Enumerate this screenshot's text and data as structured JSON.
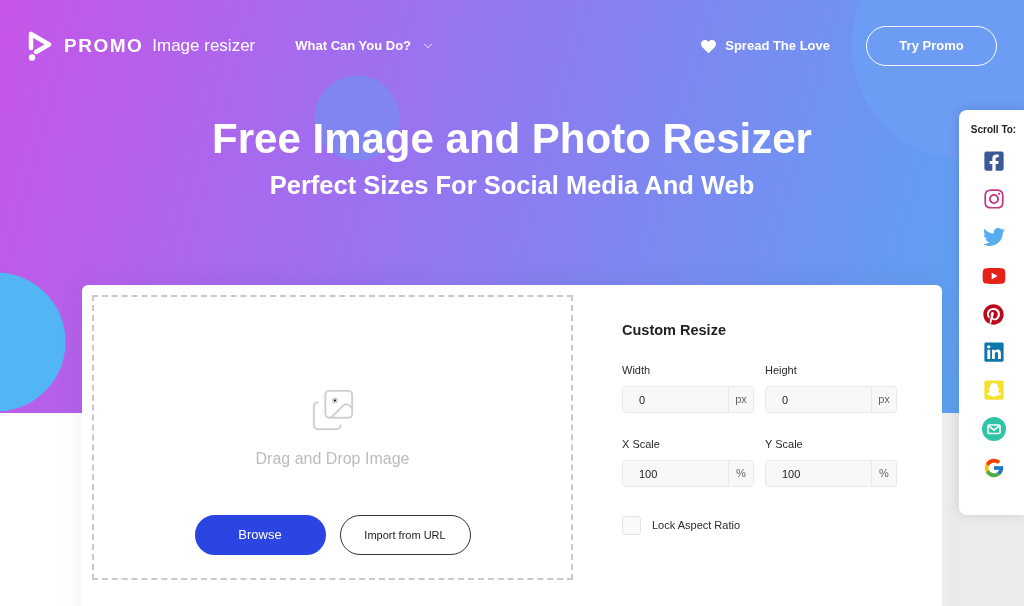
{
  "header": {
    "brand": "PROMO",
    "product": "Image resizer",
    "menu": {
      "label": "What Can You Do?"
    },
    "love_link": {
      "label": "Spread The Love"
    },
    "cta": {
      "label": "Try Promo"
    }
  },
  "hero": {
    "title": "Free Image and Photo Resizer",
    "subtitle": "Perfect Sizes For Social Media And Web"
  },
  "upload": {
    "prompt": "Drag and Drop Image",
    "buttons": [
      {
        "label": "Browse",
        "kind": "primary"
      },
      {
        "label": "Import from URL",
        "kind": "outline"
      }
    ]
  },
  "custom_resize": {
    "title": "Custom Resize",
    "fields": [
      {
        "label": "Width",
        "value": "0",
        "unit": "px"
      },
      {
        "label": "Height",
        "value": "0",
        "unit": "px"
      },
      {
        "label": "X Scale",
        "value": "100",
        "unit": "%"
      },
      {
        "label": "Y Scale",
        "value": "100",
        "unit": "%"
      }
    ],
    "lock_aspect_ratio": {
      "label": "Lock Aspect Ratio",
      "checked": false
    }
  },
  "scroll_to": {
    "title": "Scroll To:",
    "items": [
      {
        "kind": "facebook"
      },
      {
        "kind": "instagram"
      },
      {
        "kind": "twitter"
      },
      {
        "kind": "youtube"
      },
      {
        "kind": "pinterest"
      },
      {
        "kind": "linkedin"
      },
      {
        "kind": "snapchat"
      },
      {
        "kind": "email"
      },
      {
        "kind": "google"
      }
    ]
  }
}
